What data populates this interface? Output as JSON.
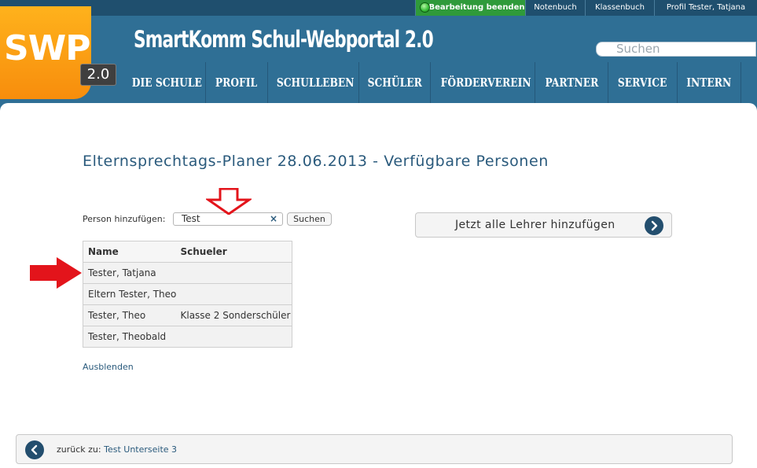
{
  "topbar": {
    "edit_label": "Bearbeitung beenden",
    "notenbuch_label": "Notenbuch",
    "klassenbuch_label": "Klassenbuch",
    "profile_label": "Profil Tester, Tatjana"
  },
  "header": {
    "logo_text": "SWP",
    "logo_version": "2.0",
    "site_title": "SmartKomm Schul-Webportal 2.0",
    "search_placeholder": "Suchen"
  },
  "nav": {
    "items": [
      {
        "label": "DIE SCHULE"
      },
      {
        "label": "PROFIL"
      },
      {
        "label": "SCHULLEBEN"
      },
      {
        "label": "SCHÜLER"
      },
      {
        "label": "FÖRDERVEREIN"
      },
      {
        "label": "PARTNER"
      },
      {
        "label": "SERVICE"
      },
      {
        "label": "INTERN"
      }
    ]
  },
  "main": {
    "page_title": "Elternsprechtags-Planer 28.06.2013 - Verfügbare Personen",
    "add_person_label": "Person hinzufügen:",
    "person_input_value": "Test",
    "clear_symbol": "×",
    "search_button": "Suchen",
    "add_all_button": "Jetzt alle Lehrer hinzufügen",
    "table": {
      "headers": [
        "Name",
        "Schueler"
      ],
      "rows": [
        {
          "name": "Tester, Tatjana",
          "schueler": ""
        },
        {
          "name": "Eltern Tester, Theo",
          "schueler": ""
        },
        {
          "name": "Tester, Theo",
          "schueler": "Klasse 2 Sonderschüler"
        },
        {
          "name": "Tester, Theobald",
          "schueler": ""
        }
      ]
    },
    "hide_link": "Ausblenden",
    "back_prefix": "zurück zu:",
    "back_target": "Test Unterseite 3"
  },
  "colors": {
    "header_blue": "#2f6f95",
    "topbar_dark": "#1f4f6e",
    "logo_orange": "#f78d0c",
    "edit_green": "#2f9a3a",
    "button_icon_navy": "#234e6e",
    "annotation_red": "#e3141b"
  },
  "icons": {
    "add_all": "chevron-right-icon",
    "back": "chevron-left-icon",
    "edit_status": "green-dot-icon",
    "clear": "close-icon"
  }
}
